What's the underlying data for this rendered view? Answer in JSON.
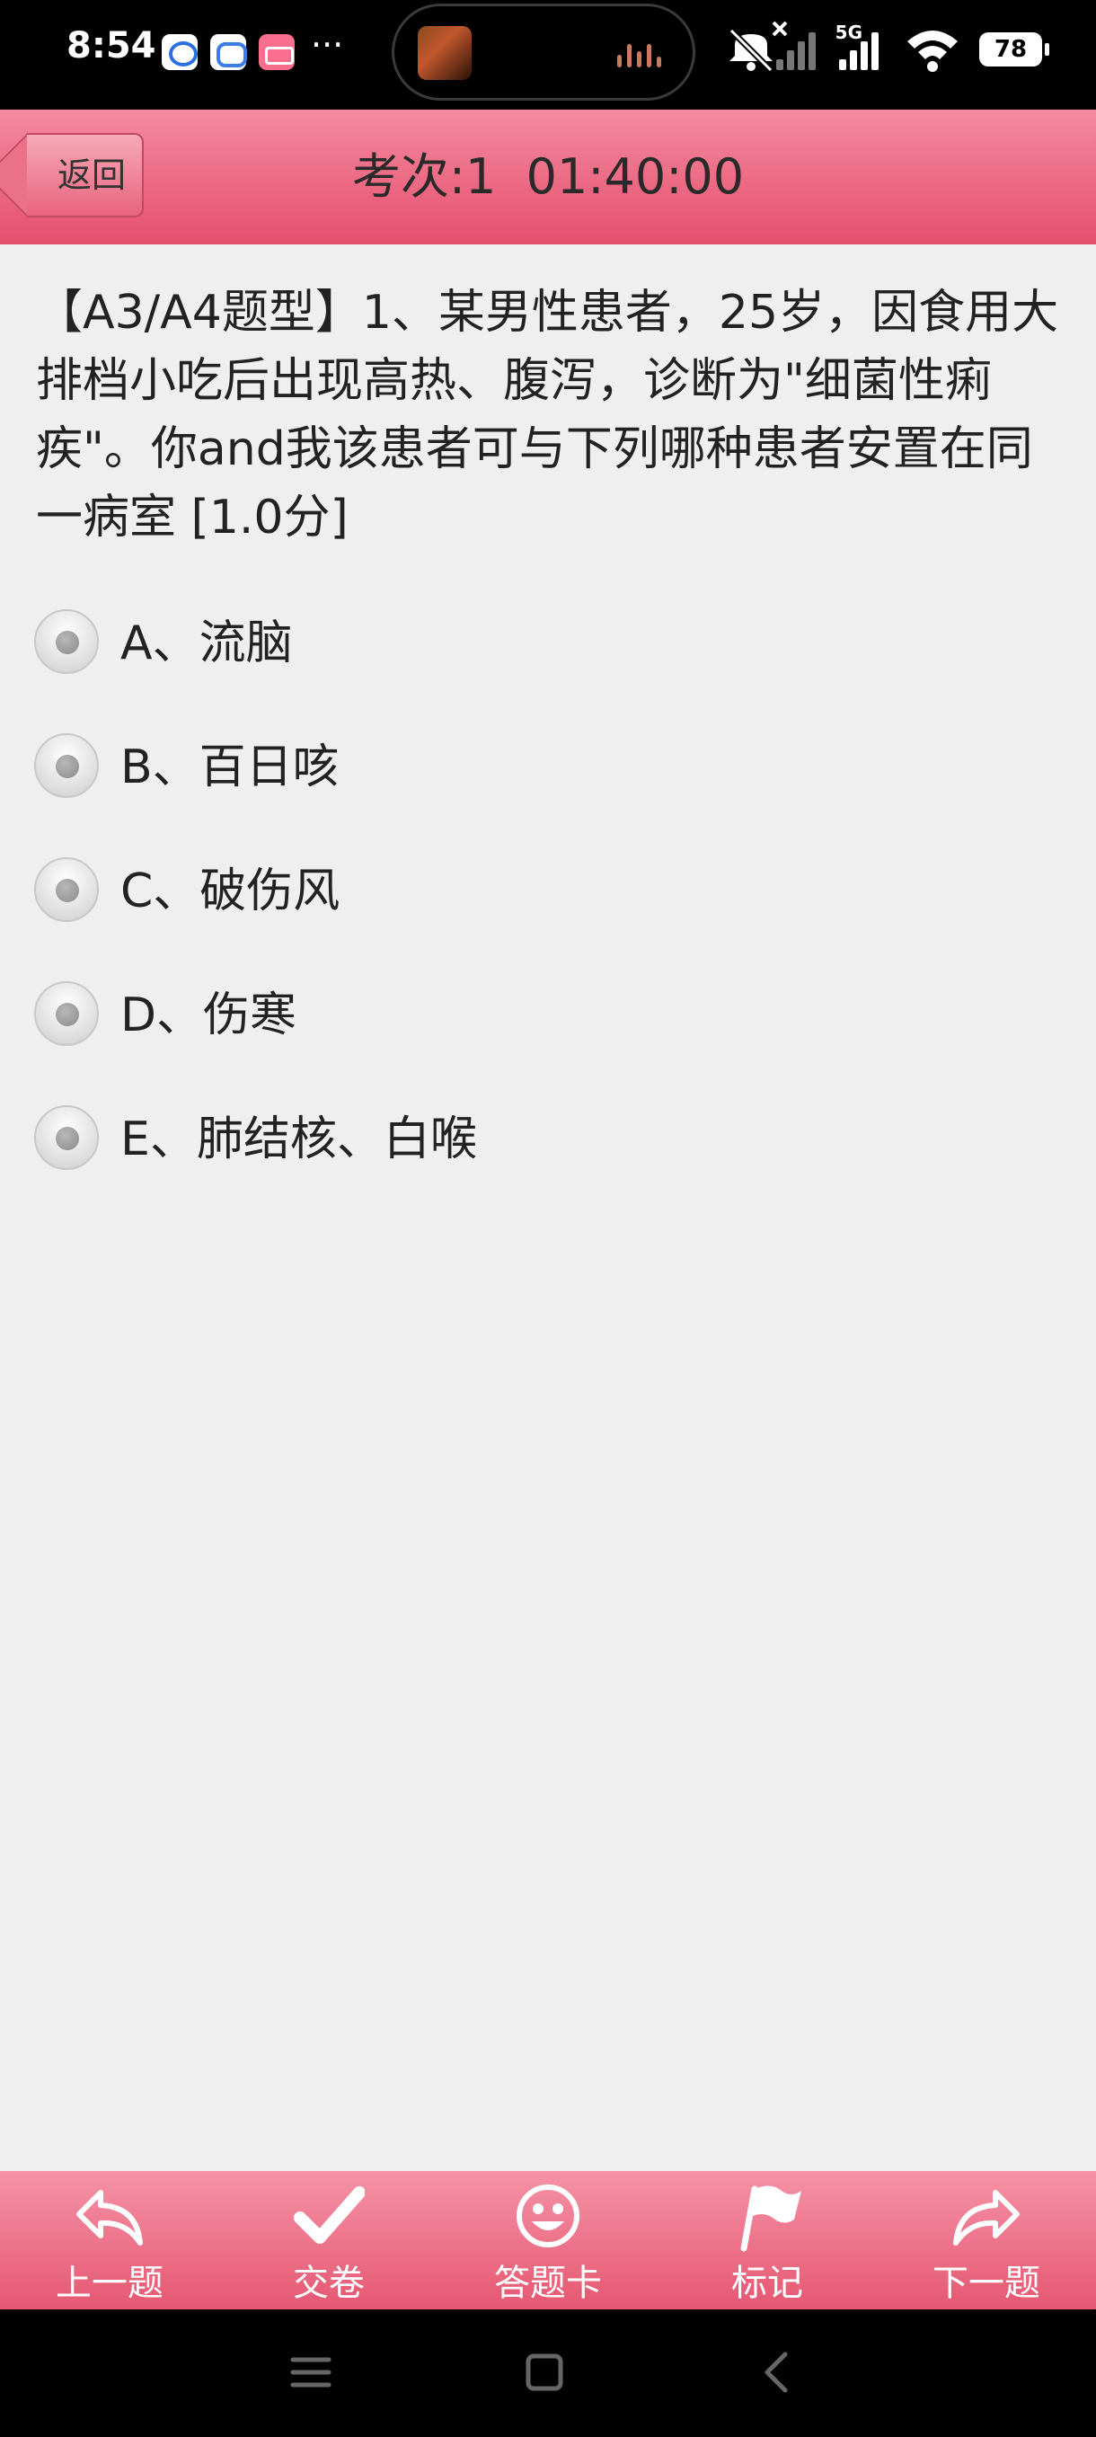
{
  "status_bar": {
    "time": "8:54",
    "more": "···",
    "network": "5G",
    "battery": "78"
  },
  "header": {
    "back_label": "返回",
    "exam_label": "考次:1",
    "timer": "01:40:00",
    "accent_color": "#e55772"
  },
  "question": {
    "text": "【A3/A4题型】1、某男性患者，25岁，因食用大排档小吃后出现高热、腹泻，诊断为\"细菌性痢疾\"。你and我该患者可与下列哪种患者安置在同一病室 [1.0分]"
  },
  "options": [
    {
      "label": "A、流脑"
    },
    {
      "label": "B、百日咳"
    },
    {
      "label": "C、破伤风"
    },
    {
      "label": "D、伤寒"
    },
    {
      "label": "E、肺结核、白喉"
    }
  ],
  "toolbar": {
    "prev": "上一题",
    "submit": "交卷",
    "answer_card": "答题卡",
    "mark": "标记",
    "next": "下一题"
  },
  "icons": {
    "prev": "reply-arrow-icon",
    "submit": "checkmark-icon",
    "answer_card": "smiley-icon",
    "mark": "flag-icon",
    "next": "forward-arrow-icon"
  }
}
